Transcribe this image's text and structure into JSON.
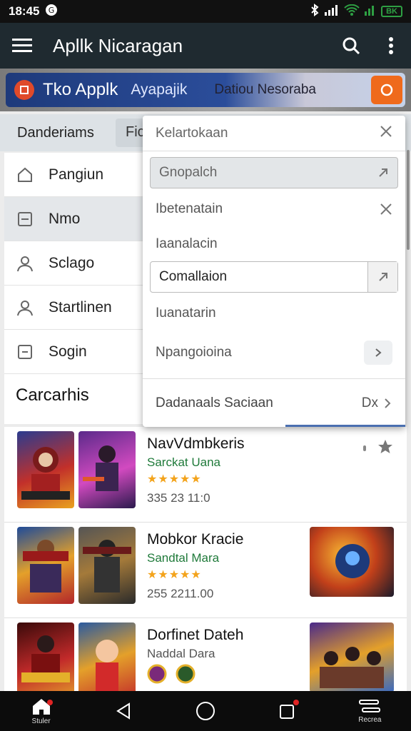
{
  "status": {
    "time": "18:45",
    "battery": "BK"
  },
  "appbar": {
    "title": "Apllk Nicaragan"
  },
  "banner": {
    "title": "Tko Applk",
    "subtitle": "Ayapajik",
    "tag": "Datiou Nesoraba"
  },
  "tabs": {
    "first": "Danderiams",
    "second": "Fic"
  },
  "sidebar": {
    "items": [
      {
        "label": "Pangiun",
        "icon": "home-icon",
        "active": false
      },
      {
        "label": "Nmo",
        "icon": "square-icon",
        "active": true
      },
      {
        "label": "Sclago",
        "icon": "person-icon",
        "active": false
      },
      {
        "label": "Startlinen",
        "icon": "person-icon",
        "active": false
      },
      {
        "label": "Sogin",
        "icon": "minus-box-icon",
        "active": false
      }
    ],
    "section_title": "Carcarhis"
  },
  "dropdown": {
    "search_placeholder": "Kelartokaan",
    "options": [
      {
        "label": "Gnopalch"
      },
      {
        "label": "Ibetenatain"
      },
      {
        "label": "Iaanalacin"
      },
      {
        "label": "Comallaion"
      },
      {
        "label": "Iuanatarin"
      },
      {
        "label": "Npangoioina"
      }
    ],
    "footer_label": "Dadanaals Saciaan",
    "footer_right": "Dx"
  },
  "feed": {
    "items": [
      {
        "name": "NavVdmbkeris",
        "developer": "Sarckat Uana",
        "stars": "★★★★★",
        "meta": "335 23 11:0"
      },
      {
        "name": "Mobkor Kracie",
        "developer": "Sandtal Mara",
        "stars": "★★★★★",
        "meta": "255 2211.00"
      },
      {
        "name": "Dorfinet Dateh",
        "developer": "Naddal Dara"
      }
    ]
  },
  "navbar": {
    "home_label": "Stuler",
    "menu_label": "Recrea"
  },
  "colors": {
    "appbar": "#1f2a30",
    "banner": "#2b4d9a",
    "accent_orange": "#ef6a1c",
    "developer_green": "#1f7a3a",
    "star": "#f3a31b"
  }
}
